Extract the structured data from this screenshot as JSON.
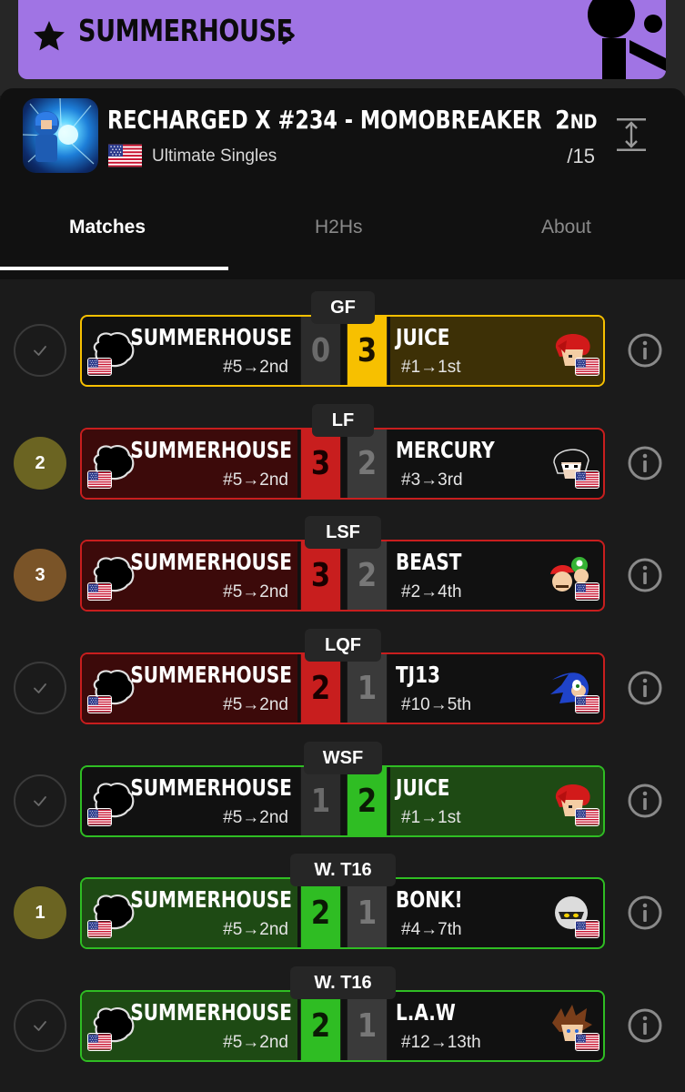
{
  "colors": {
    "banner": "#a074e4",
    "loss_border": "#c81e1e",
    "win_border": "#2fbd23",
    "gold_border": "#f7c000",
    "badge_gold": "#6b6422",
    "badge_bronze": "#7a5428"
  },
  "banner": {
    "player_name": "SUMMERHOUSE",
    "star_icon": "star-icon",
    "chevron_icon": "chevron-right-icon"
  },
  "event": {
    "title": "RECHARGED X #234 - MOMOBREAKER",
    "subtitle": "Ultimate Singles",
    "placement_number": "2",
    "placement_suffix": "ND",
    "total_entrants": "/15",
    "country_flag": "us-flag"
  },
  "tabs": [
    {
      "label": "Matches",
      "active": true
    },
    {
      "label": "H2Hs",
      "active": false
    },
    {
      "label": "About",
      "active": false
    }
  ],
  "matches": [
    {
      "round": "GF",
      "status": "check",
      "p1": {
        "name": "SUMMERHOUSE",
        "seed": "#5→2nd",
        "score": "0"
      },
      "p2": {
        "name": "JUICE",
        "seed": "#1→1st",
        "score": "3",
        "character": "roy-icon"
      },
      "result": "gold"
    },
    {
      "round": "LF",
      "status": "2",
      "p1": {
        "name": "SUMMERHOUSE",
        "seed": "#5→2nd",
        "score": "3"
      },
      "p2": {
        "name": "MERCURY",
        "seed": "#3→3rd",
        "score": "2",
        "character": "joker-icon"
      },
      "result": "loss"
    },
    {
      "round": "LSF",
      "status": "3",
      "p1": {
        "name": "SUMMERHOUSE",
        "seed": "#5→2nd",
        "score": "3"
      },
      "p2": {
        "name": "BEAST",
        "seed": "#2→4th",
        "score": "2",
        "character": "mario-luigi-icon"
      },
      "result": "loss"
    },
    {
      "round": "LQF",
      "status": "check",
      "p1": {
        "name": "SUMMERHOUSE",
        "seed": "#5→2nd",
        "score": "2"
      },
      "p2": {
        "name": "TJ13",
        "seed": "#10→5th",
        "score": "1",
        "character": "sonic-icon"
      },
      "result": "loss"
    },
    {
      "round": "WSF",
      "status": "check",
      "p1": {
        "name": "SUMMERHOUSE",
        "seed": "#5→2nd",
        "score": "1"
      },
      "p2": {
        "name": "JUICE",
        "seed": "#1→1st",
        "score": "2",
        "character": "roy-icon"
      },
      "result": "win-right"
    },
    {
      "round": "W. T16",
      "status": "1",
      "p1": {
        "name": "SUMMERHOUSE",
        "seed": "#5→2nd",
        "score": "2"
      },
      "p2": {
        "name": "BONK!",
        "seed": "#4→7th",
        "score": "1",
        "character": "meta-knight-icon"
      },
      "result": "win-left"
    },
    {
      "round": "W. T16",
      "status": "check",
      "p1": {
        "name": "SUMMERHOUSE",
        "seed": "#5→2nd",
        "score": "2"
      },
      "p2": {
        "name": "L.A.W",
        "seed": "#12→13th",
        "score": "1",
        "character": "sora-icon"
      },
      "result": "win-left"
    }
  ]
}
